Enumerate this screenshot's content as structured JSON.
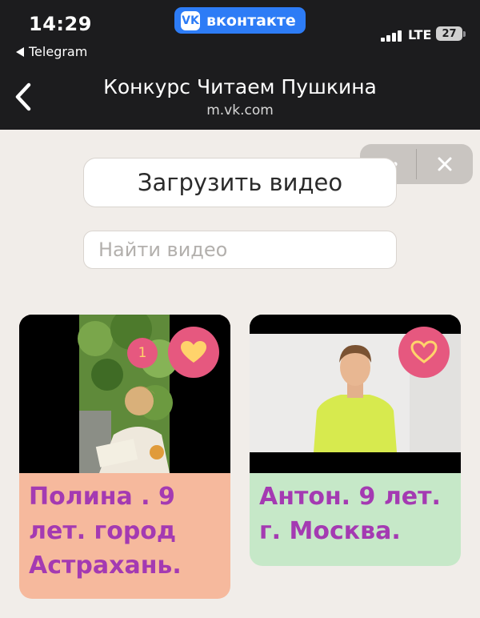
{
  "status_bar": {
    "time": "14:29",
    "back_app": "Telegram",
    "network": "LTE",
    "battery": "27"
  },
  "vk_badge": {
    "label": "вконтакте"
  },
  "header": {
    "title": "Конкурс Читаем Пушкина",
    "subtitle": "m.vk.com"
  },
  "actions": {
    "upload_label": "Загрузить видео",
    "search_placeholder": "Найти видео"
  },
  "videos": [
    {
      "caption": "Полина . 9 лет. город Астрахань.",
      "likes": "1",
      "liked": true,
      "card_color": "#f6b99d"
    },
    {
      "caption": "Антон. 9 лет. г. Москва.",
      "likes": "",
      "liked": false,
      "card_color": "#c6e8c8"
    }
  ],
  "colors": {
    "accent_pink": "#e6587f",
    "heart_fill": "#ffd36b",
    "caption_text": "#a43ab2",
    "vk_blue": "#2d7cf6"
  }
}
